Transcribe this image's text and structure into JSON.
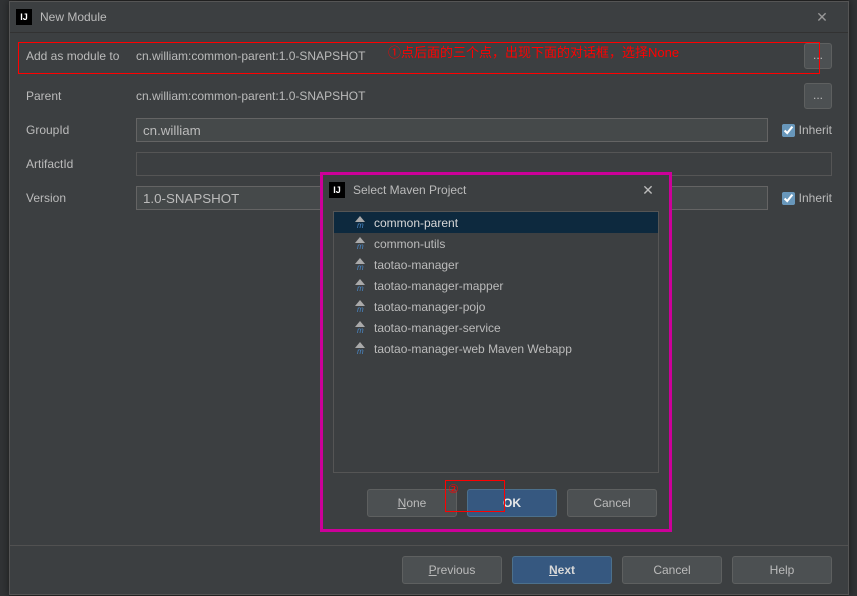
{
  "window": {
    "title": "New Module",
    "close_glyph": "✕"
  },
  "fields": {
    "addAsModule": {
      "label": "Add as module to",
      "value": "cn.william:common-parent:1.0-SNAPSHOT"
    },
    "parent": {
      "label": "Parent",
      "value": "cn.william:common-parent:1.0-SNAPSHOT"
    },
    "groupId": {
      "label": "GroupId",
      "value": "cn.william",
      "inherit": "Inherit"
    },
    "artifactId": {
      "label": "ArtifactId",
      "value": ""
    },
    "version": {
      "label": "Version",
      "value": "1.0-SNAPSHOT",
      "inherit": "Inherit"
    },
    "browse": "..."
  },
  "footer": {
    "previous": "Previous",
    "next": "Next",
    "cancel": "Cancel",
    "help": "Help"
  },
  "modal": {
    "title": "Select Maven Project",
    "close_glyph": "✕",
    "items": [
      "common-parent",
      "common-utils",
      "taotao-manager",
      "taotao-manager-mapper",
      "taotao-manager-pojo",
      "taotao-manager-service",
      "taotao-manager-web Maven Webapp"
    ],
    "buttons": {
      "none": "None",
      "ok": "OK",
      "cancel": "Cancel"
    }
  },
  "annotations": {
    "a1_prefix": "①",
    "a1_text": "点后面的三个点，出现下面的对话框，选择None",
    "a2_prefix": "②"
  }
}
